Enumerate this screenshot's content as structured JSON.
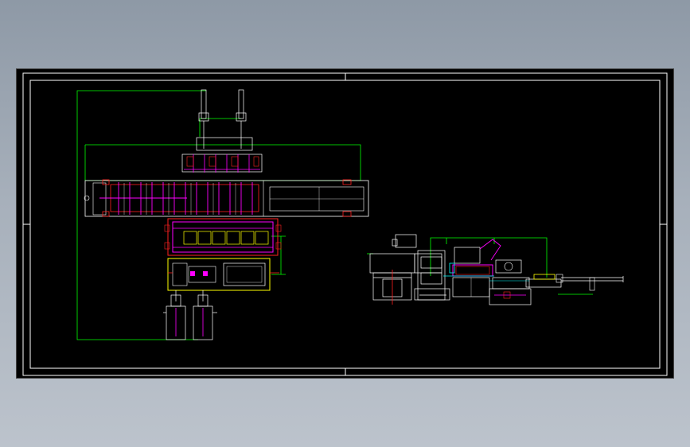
{
  "colors": {
    "background": "#000000",
    "frame": "#ffffff",
    "dimension": "#00ff00",
    "magenta": "#ff00ff",
    "red": "#ff2020",
    "yellow": "#ffff00",
    "cyan": "#00ffff",
    "white": "#ffffff",
    "page_gradient_top": "#8e99a6",
    "page_gradient_bottom": "#bcc3cc"
  },
  "labels": {
    "dim_left_upper": "",
    "dim_left_lower": "",
    "dim_top": "",
    "dim_right_label": "",
    "dim_side_top": "",
    "dim_side_right": ""
  }
}
